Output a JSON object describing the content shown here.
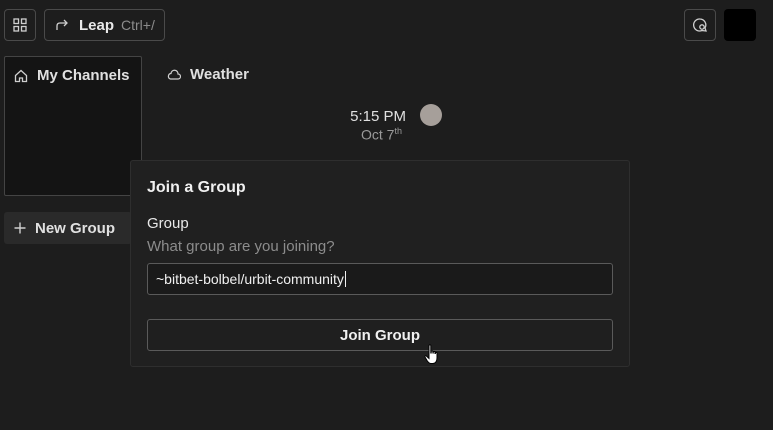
{
  "header": {
    "apps_icon": "grid-icon",
    "leap": {
      "label": "Leap",
      "shortcut": "Ctrl+/",
      "icon": "arrow-redo-icon"
    },
    "notifications_icon": "chat-search-icon",
    "avatar_color": "#000000"
  },
  "sidebar": {
    "my_channels": {
      "label": "My Channels",
      "icon": "home-icon"
    },
    "new_group": {
      "label": "New Group",
      "icon": "plus-icon"
    }
  },
  "tiles": {
    "weather": {
      "label": "Weather",
      "icon": "cloud-icon"
    },
    "clock": {
      "time": "5:15 PM",
      "date": "Oct 7",
      "suffix": "th",
      "icon": "moon-icon"
    }
  },
  "dialog": {
    "title": "Join a Group",
    "field_label": "Group",
    "field_hint": "What group are you joining?",
    "input_value": "~bitbet-bolbel/urbit-community",
    "submit_label": "Join Group"
  },
  "colors": {
    "background": "#1d1d1d",
    "panel": "#222222",
    "border": "#4a4a4a",
    "text": "#e8e8e8",
    "muted": "#8c8c8c"
  }
}
